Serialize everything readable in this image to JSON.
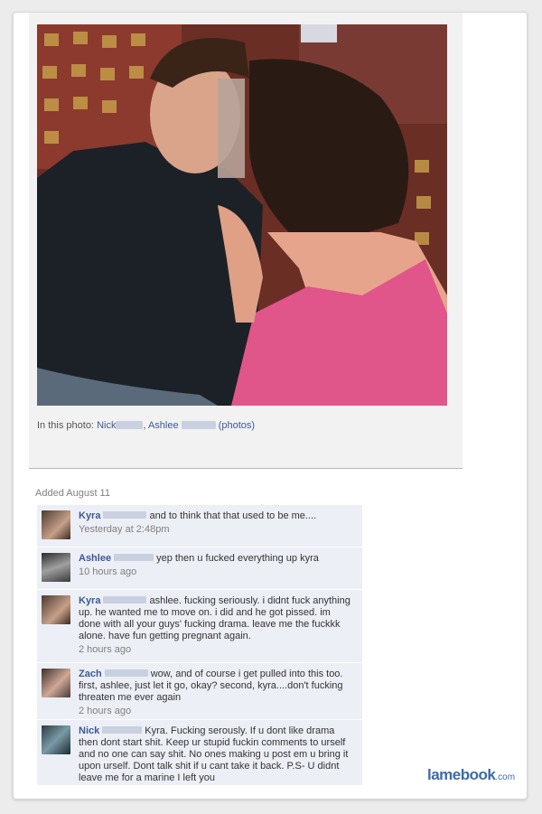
{
  "photo": {
    "caption_prefix": "In this photo:",
    "tags": [
      "Nick",
      "Ashlee"
    ],
    "tag_separator": ",",
    "photos_link": "(photos)"
  },
  "added_label": "Added August 11",
  "comments": [
    {
      "name": "Kyra",
      "text": "and to think that that used to be me....",
      "time": "Yesterday at 2:48pm"
    },
    {
      "name": "Ashlee",
      "text": "yep then u fucked everything up kyra",
      "time": "10 hours ago"
    },
    {
      "name": "Kyra",
      "text": "ashlee. fucking seriously. i didnt fuck anything up. he wanted me to move on. i did and he got pissed. im done with all your guys' fucking drama. leave me the fuckkk alone. have fun getting pregnant again.",
      "time": "2 hours ago"
    },
    {
      "name": "Zach",
      "text": "wow, and of course i get pulled into this too. first, ashlee, just let it go, okay? second, kyra....don't fucking threaten me ever again",
      "time": "2 hours ago"
    },
    {
      "name": "Nick",
      "text": "Kyra. Fucking serously. If u dont like drama then dont start shit. Keep ur stupid fuckin comments to urself and no one can say shit. No ones making u post em u bring it upon urself. Dont talk shit if u cant take it back. P.S- U didnt leave me for a marine I left you",
      "time": ""
    }
  ],
  "brand": {
    "name": "lamebook",
    "suffix": ".com"
  },
  "colors": {
    "link": "#3b5998",
    "comment_bg": "#eceff5",
    "brand": "#3d6aa8"
  }
}
